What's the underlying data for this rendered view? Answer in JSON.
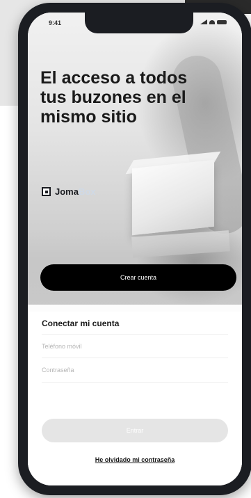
{
  "status_bar": {
    "time": "9:41"
  },
  "hero": {
    "headline": "El acceso a todos tus buzones en el mismo sitio"
  },
  "brand": {
    "name_primary": "Joma",
    "name_accent": "Box",
    "icon": "square-logo-icon"
  },
  "actions": {
    "create_account_label": "Crear cuenta"
  },
  "login": {
    "title": "Conectar mi cuenta",
    "phone_placeholder": "Teléfono móvil",
    "password_placeholder": "Contraseña",
    "enter_label": "Entrar",
    "forgot_password_label": "He olvidado mi contraseña"
  }
}
